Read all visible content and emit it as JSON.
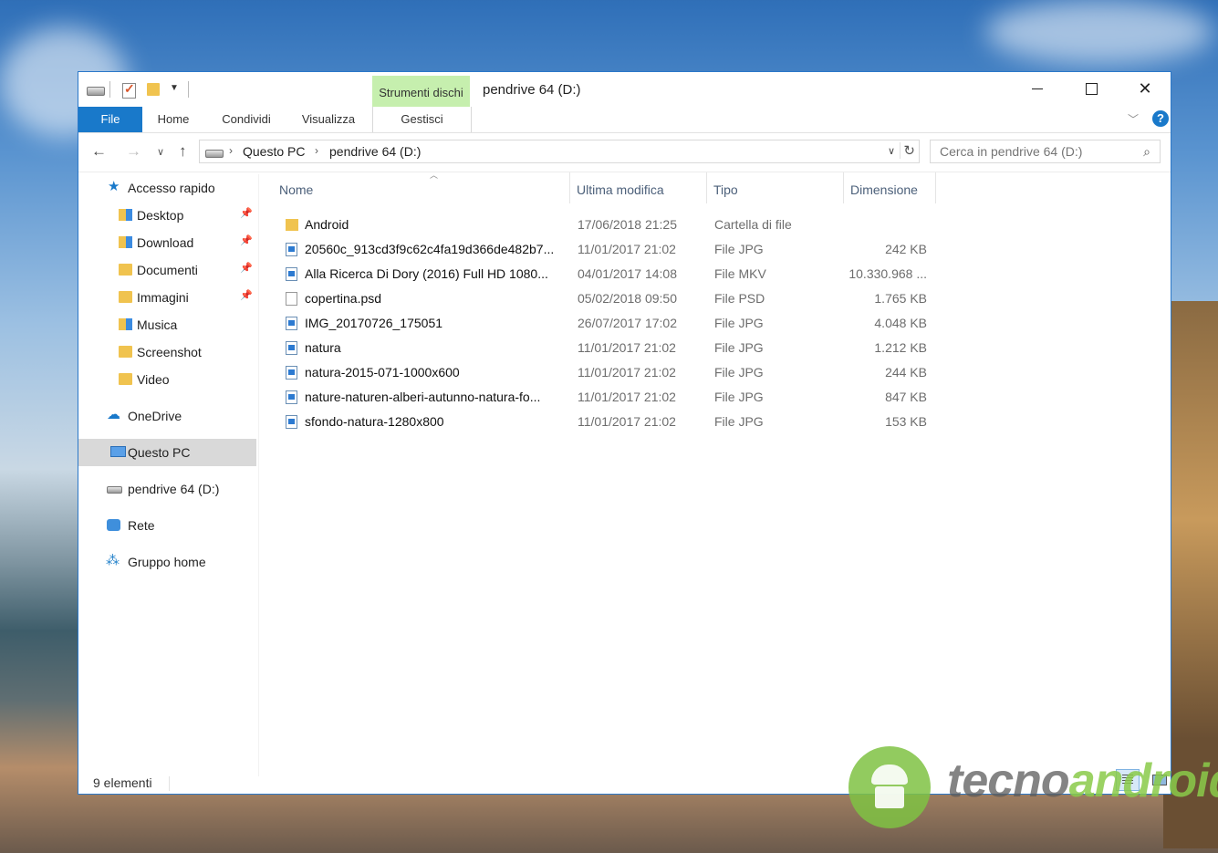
{
  "window": {
    "title": "pendrive 64 (D:)",
    "contextual_tab_group": "Strumenti dischi",
    "controls": {
      "minimize": "minimize",
      "maximize": "maximize",
      "close": "✕"
    }
  },
  "ribbon": {
    "tabs": [
      {
        "label": "File"
      },
      {
        "label": "Home"
      },
      {
        "label": "Condividi"
      },
      {
        "label": "Visualizza"
      },
      {
        "label": "Gestisci"
      }
    ],
    "help": "?"
  },
  "address": {
    "crumbs": [
      "Questo PC",
      "pendrive 64 (D:)"
    ]
  },
  "search": {
    "placeholder": "Cerca in pendrive 64 (D:)"
  },
  "sidebar": {
    "items": [
      {
        "label": "Accesso rapido",
        "icon": "star-icon"
      },
      {
        "label": "Desktop",
        "icon": "desktop-folder-icon",
        "pinned": true
      },
      {
        "label": "Download",
        "icon": "download-folder-icon",
        "pinned": true
      },
      {
        "label": "Documenti",
        "icon": "documents-folder-icon",
        "pinned": true
      },
      {
        "label": "Immagini",
        "icon": "pictures-folder-icon",
        "pinned": true
      },
      {
        "label": "Musica",
        "icon": "music-folder-icon"
      },
      {
        "label": "Screenshot",
        "icon": "folder-icon"
      },
      {
        "label": "Video",
        "icon": "video-folder-icon"
      },
      {
        "label": "OneDrive",
        "icon": "cloud-icon"
      },
      {
        "label": "Questo PC",
        "icon": "computer-icon",
        "selected": true
      },
      {
        "label": "pendrive 64 (D:)",
        "icon": "drive-icon"
      },
      {
        "label": "Rete",
        "icon": "network-icon"
      },
      {
        "label": "Gruppo home",
        "icon": "homegroup-icon"
      }
    ]
  },
  "columns": {
    "name": "Nome",
    "modified": "Ultima modifica",
    "type": "Tipo",
    "size": "Dimensione"
  },
  "files": [
    {
      "name": "Android",
      "modified": "17/06/2018 21:25",
      "type": "Cartella di file",
      "size": "",
      "icon": "folder-icon"
    },
    {
      "name": "20560c_913cd3f9c62c4fa19d366de482b7...",
      "modified": "11/01/2017 21:02",
      "type": "File JPG",
      "size": "242 KB",
      "icon": "image-file-icon"
    },
    {
      "name": "Alla Ricerca Di Dory (2016) Full HD 1080...",
      "modified": "04/01/2017 14:08",
      "type": "File MKV",
      "size": "10.330.968 ...",
      "icon": "video-file-icon"
    },
    {
      "name": "copertina.psd",
      "modified": "05/02/2018 09:50",
      "type": "File PSD",
      "size": "1.765 KB",
      "icon": "blank-file-icon"
    },
    {
      "name": "IMG_20170726_175051",
      "modified": "26/07/2017 17:02",
      "type": "File JPG",
      "size": "4.048 KB",
      "icon": "image-file-icon"
    },
    {
      "name": "natura",
      "modified": "11/01/2017 21:02",
      "type": "File JPG",
      "size": "1.212 KB",
      "icon": "image-file-icon"
    },
    {
      "name": "natura-2015-071-1000x600",
      "modified": "11/01/2017 21:02",
      "type": "File JPG",
      "size": "244 KB",
      "icon": "image-file-icon"
    },
    {
      "name": "nature-naturen-alberi-autunno-natura-fo...",
      "modified": "11/01/2017 21:02",
      "type": "File JPG",
      "size": "847 KB",
      "icon": "image-file-icon"
    },
    {
      "name": "sfondo-natura-1280x800",
      "modified": "11/01/2017 21:02",
      "type": "File JPG",
      "size": "153 KB",
      "icon": "image-file-icon"
    }
  ],
  "status": {
    "count": "9 elementi"
  },
  "watermark": {
    "text_part1": "tecno",
    "text_part2": "android"
  },
  "colors": {
    "accent": "#1979ca",
    "contextual_tab": "#c6efae",
    "selected_nav": "#d9d9d9",
    "header_text": "#4c607a"
  }
}
